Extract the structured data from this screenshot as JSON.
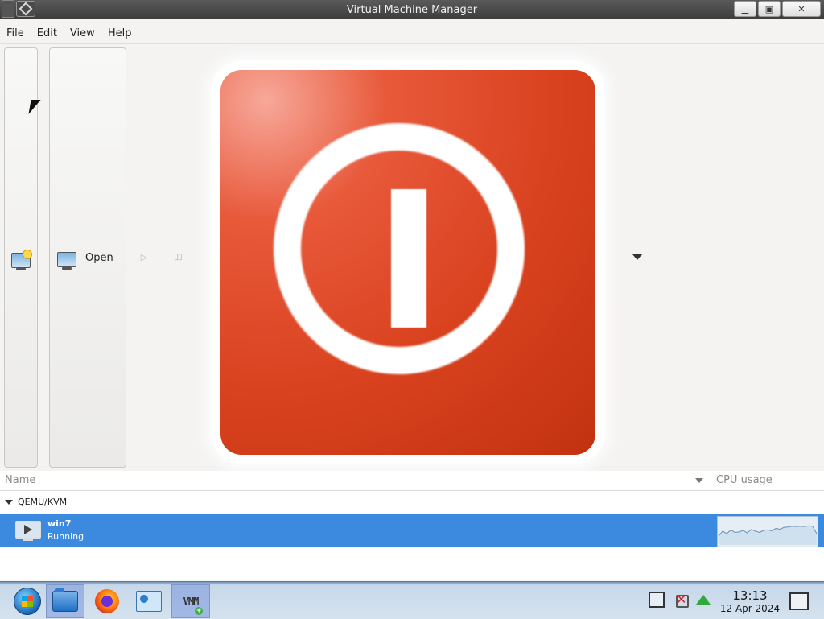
{
  "window": {
    "title": "Virtual Machine Manager"
  },
  "menubar": {
    "items": [
      "File",
      "Edit",
      "View",
      "Help"
    ]
  },
  "toolbar": {
    "open_label": "Open"
  },
  "list": {
    "columns": {
      "name": "Name",
      "cpu": "CPU usage"
    },
    "group": "QEMU/KVM",
    "vms": [
      {
        "name": "win7",
        "status": "Running",
        "cpu_history": [
          0.35,
          0.55,
          0.45,
          0.6,
          0.5,
          0.52,
          0.58,
          0.48,
          0.62,
          0.55,
          0.5,
          0.58,
          0.6,
          0.57,
          0.66,
          0.63,
          0.7,
          0.72,
          0.75,
          0.74,
          0.75,
          0.74,
          0.76,
          0.75,
          0.45
        ]
      }
    ]
  },
  "taskbar": {
    "time": "13:13",
    "date": "12 Apr 2024"
  },
  "colors": {
    "selection": "#3b8ae0",
    "shutdown_red": "#d9421f"
  }
}
